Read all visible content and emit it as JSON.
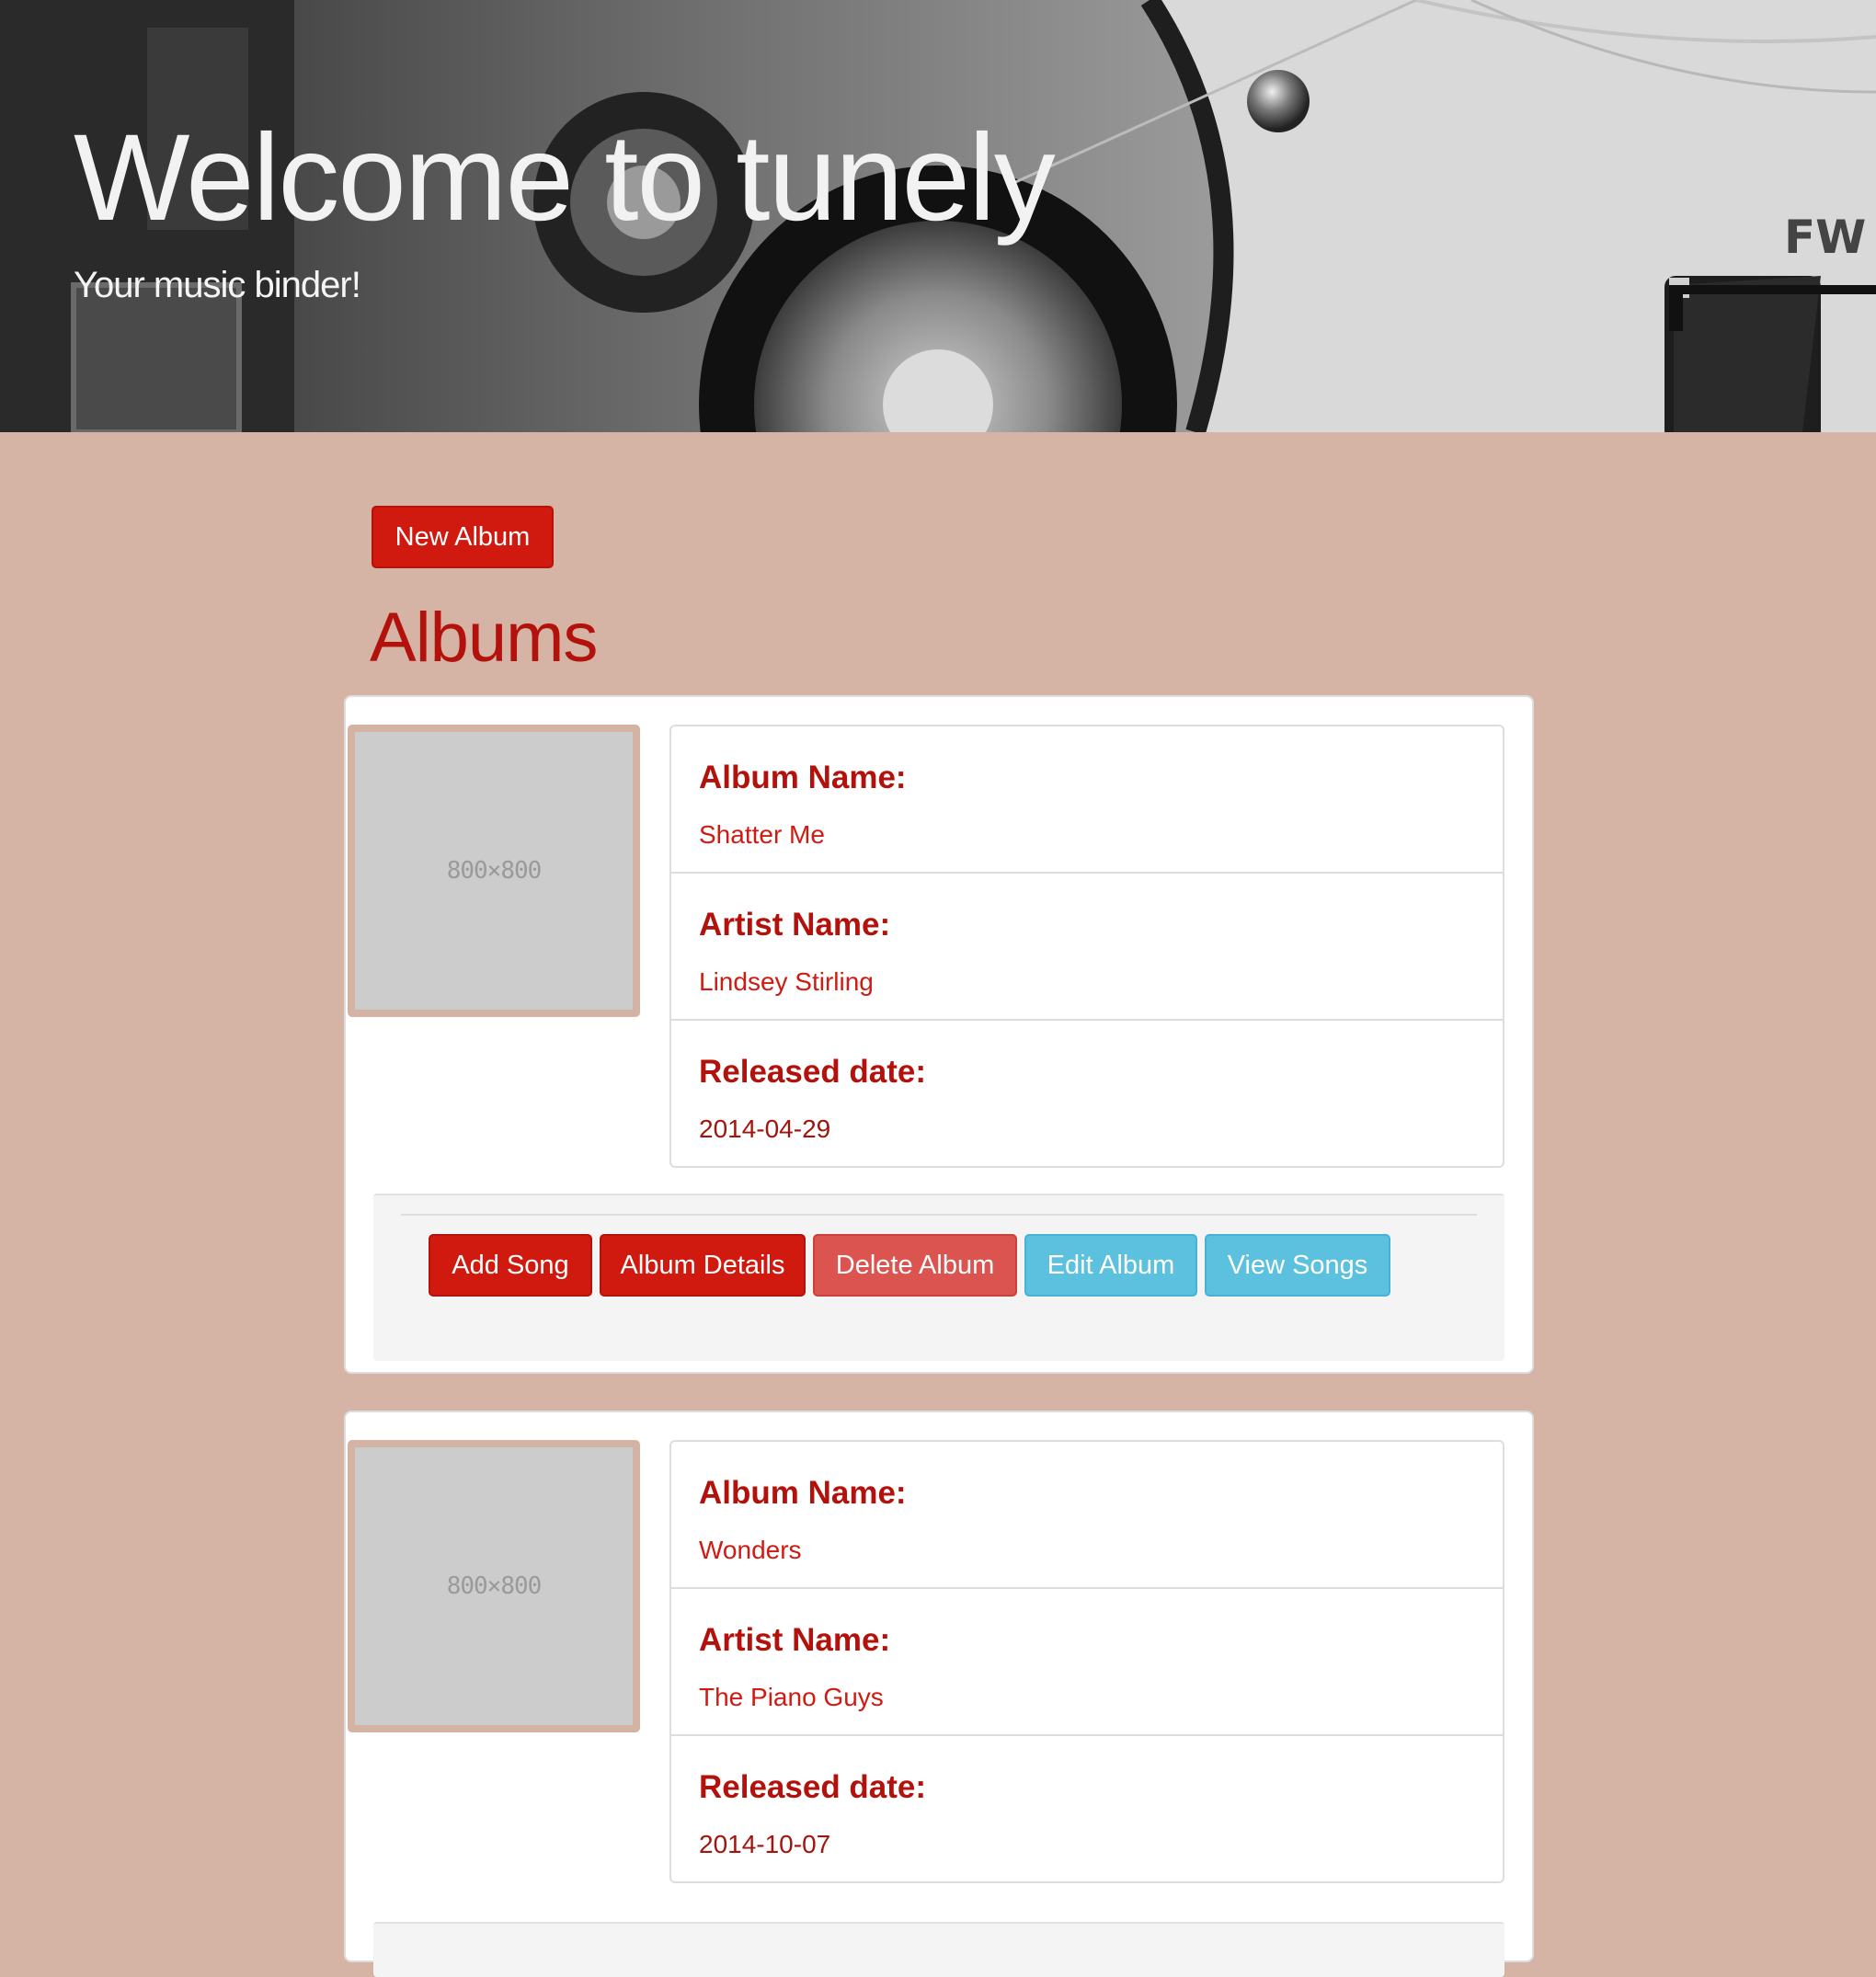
{
  "hero": {
    "title": "Welcome to tunely",
    "subtitle": "Your music binder!"
  },
  "toolbar": {
    "new_album_label": "New Album"
  },
  "albums_section": {
    "title": "Albums"
  },
  "labels": {
    "album_name": "Album Name:",
    "artist_name": "Artist Name:",
    "released_date": "Released date:"
  },
  "albums": [
    {
      "cover_placeholder": "800×800",
      "album_name": "Shatter Me",
      "artist_name": "Lindsey Stirling",
      "released_date": "2014-04-29",
      "actions": {
        "add_song": "Add Song",
        "album_details": "Album Details",
        "delete_album": "Delete Album",
        "edit_album": "Edit Album",
        "view_songs": "View Songs"
      }
    },
    {
      "cover_placeholder": "800×800",
      "album_name": "Wonders",
      "artist_name": "The Piano Guys",
      "released_date": "2014-10-07"
    }
  ],
  "colors": {
    "page_background": "#d5b3a5",
    "primary": "#d0190f",
    "danger_light": "#dc5450",
    "info": "#5cc0df",
    "heading": "#b3120c"
  }
}
